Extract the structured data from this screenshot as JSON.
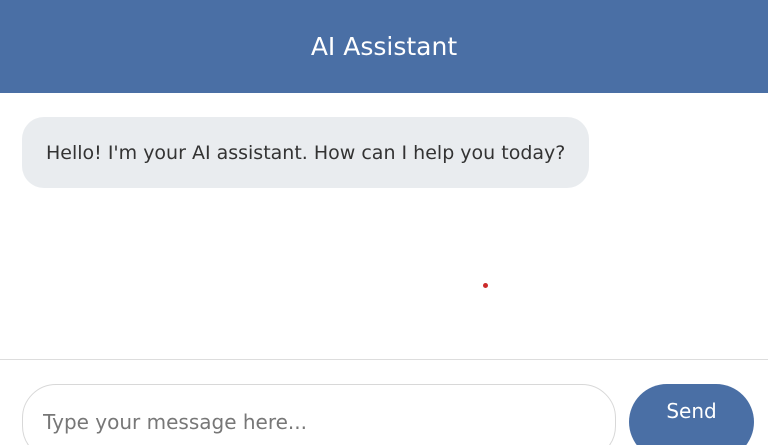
{
  "header": {
    "title": "AI Assistant"
  },
  "chat": {
    "messages": [
      {
        "role": "assistant",
        "text": "Hello! I'm your AI assistant. How can I help you today?"
      }
    ]
  },
  "composer": {
    "placeholder": "Type your message here...",
    "value": "",
    "send_label": "Send"
  },
  "colors": {
    "accent": "#4a6fa5",
    "bubble_bg": "#e9ecef",
    "cursor_dot": "#cc2b2b"
  }
}
